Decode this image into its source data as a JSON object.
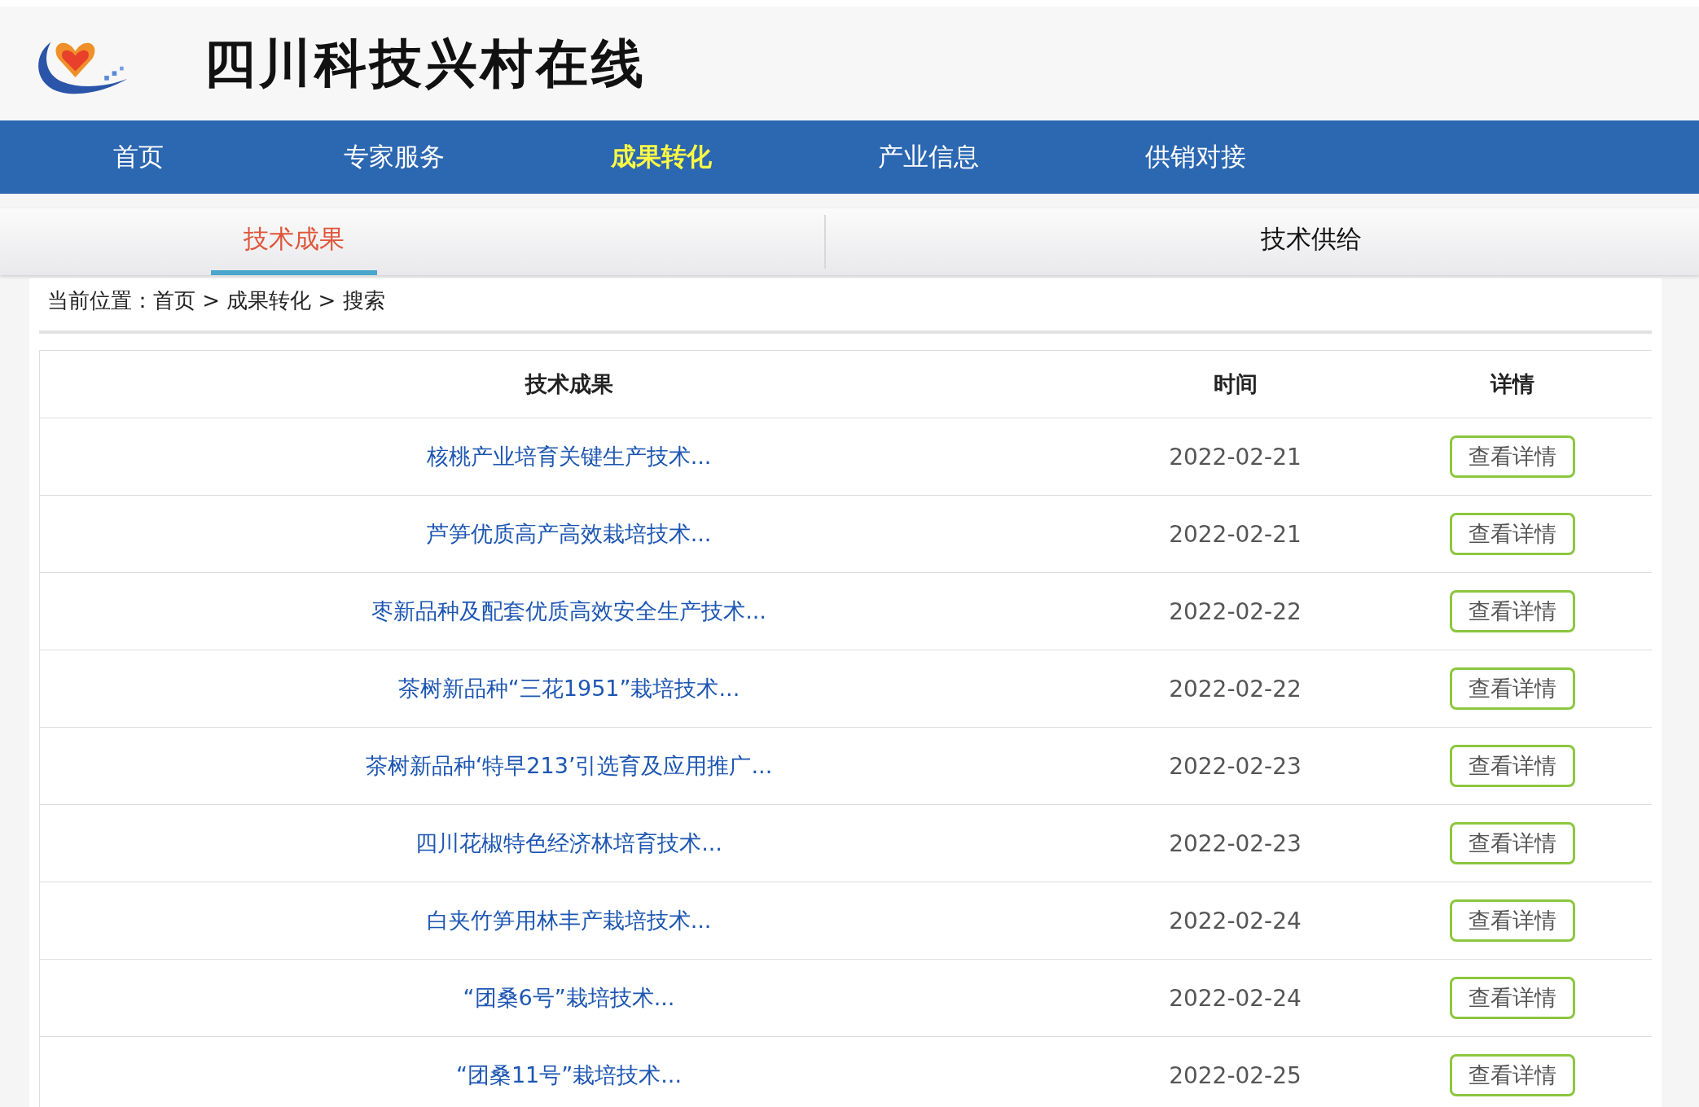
{
  "site": {
    "title": "四川科技兴村在线"
  },
  "nav": [
    {
      "label": "首页",
      "selected": false
    },
    {
      "label": "专家服务",
      "selected": false
    },
    {
      "label": "成果转化",
      "selected": true
    },
    {
      "label": "产业信息",
      "selected": false
    },
    {
      "label": "供销对接",
      "selected": false
    }
  ],
  "tabs": [
    {
      "label": "技术成果",
      "selected": true
    },
    {
      "label": "技术供给",
      "selected": false
    }
  ],
  "breadcrumb": "当前位置：首页 > 成果转化 > 搜索",
  "table": {
    "columns": [
      "技术成果",
      "时间",
      "详情"
    ],
    "rows": [
      {
        "title": "核桃产业培育关键生产技术...",
        "date": "2022-02-21",
        "action": "查看详情"
      },
      {
        "title": "芦笋优质高产高效栽培技术...",
        "date": "2022-02-21",
        "action": "查看详情"
      },
      {
        "title": "枣新品种及配套优质高效安全生产技术...",
        "date": "2022-02-22",
        "action": "查看详情"
      },
      {
        "title": "茶树新品种“三花1951”栽培技术...",
        "date": "2022-02-22",
        "action": "查看详情"
      },
      {
        "title": "茶树新品种‘特早213’引选育及应用推广...",
        "date": "2022-02-23",
        "action": "查看详情"
      },
      {
        "title": "四川花椒特色经济林培育技术...",
        "date": "2022-02-23",
        "action": "查看详情"
      },
      {
        "title": "白夹竹笋用林丰产栽培技术...",
        "date": "2022-02-24",
        "action": "查看详情"
      },
      {
        "title": "“团桑6号”栽培技术...",
        "date": "2022-02-24",
        "action": "查看详情"
      },
      {
        "title": "“团桑11号”栽培技术...",
        "date": "2022-02-25",
        "action": "查看详情"
      }
    ]
  }
}
